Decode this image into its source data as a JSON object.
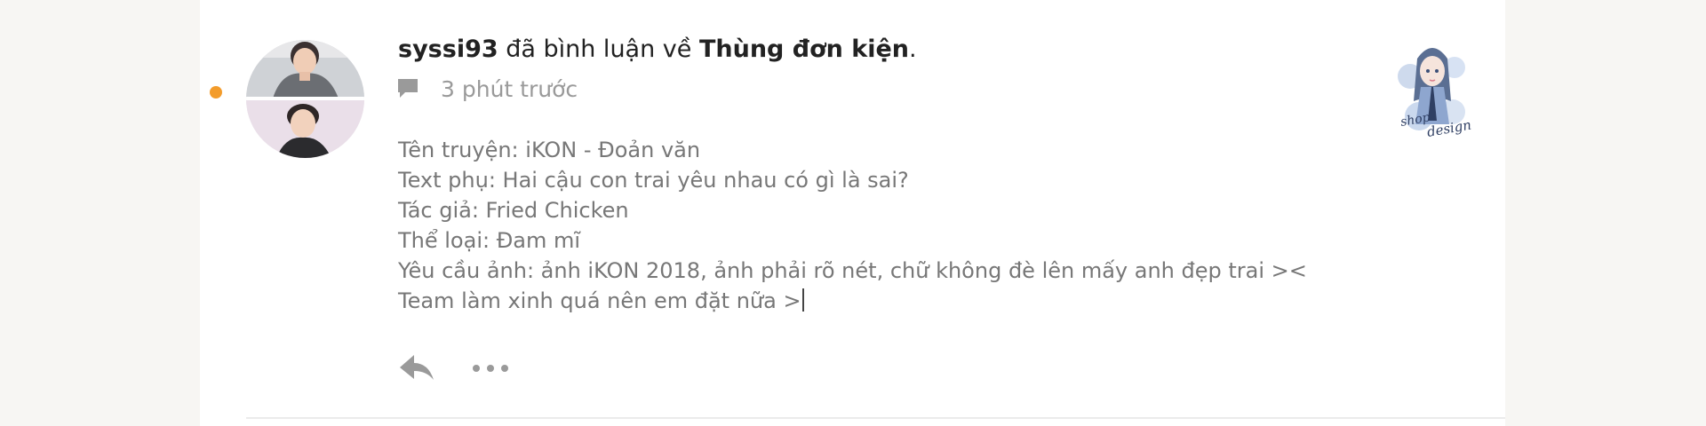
{
  "notification": {
    "username": "syssi93",
    "action_text": " đã bình luận về ",
    "story_title": "Thùng đơn kiện",
    "trailing_punct": ".",
    "time_ago": "3 phút trước",
    "comment_lines": [
      "Tên truyện: iKON - Đoản văn",
      "Text phụ: Hai cậu con trai yêu nhau có gì là sai?",
      "Tác giả: Fried Chicken",
      "Thể loại: Đam mĩ",
      "Yêu cầu ảnh: ảnh iKON 2018, ảnh phải rõ nét, chữ không đè lên mấy anh đẹp trai ><",
      "Team làm xinh quá nên em đặt nữa >"
    ],
    "thumbnail_text": "shop design",
    "icons": {
      "comment": "comment-icon",
      "reply": "reply-icon",
      "more": "more-icon"
    },
    "colors": {
      "unread_dot": "#f39c2b",
      "muted_text": "#9a9a9a",
      "body_text": "#777777"
    }
  }
}
